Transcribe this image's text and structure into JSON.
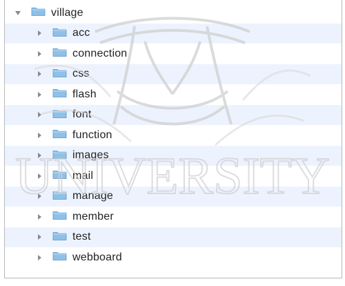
{
  "window": {
    "root_folder": {
      "name": "village",
      "icon": "folder-icon",
      "expanded": true
    },
    "children": [
      {
        "name": "acc",
        "icon": "folder-icon",
        "expanded": false
      },
      {
        "name": "connection",
        "icon": "folder-icon",
        "expanded": false
      },
      {
        "name": "css",
        "icon": "folder-icon",
        "expanded": false
      },
      {
        "name": "flash",
        "icon": "folder-icon",
        "expanded": false
      },
      {
        "name": "font",
        "icon": "folder-icon",
        "expanded": false
      },
      {
        "name": "function",
        "icon": "folder-icon",
        "expanded": false
      },
      {
        "name": "images",
        "icon": "folder-icon",
        "expanded": false
      },
      {
        "name": "mail",
        "icon": "folder-icon",
        "expanded": false
      },
      {
        "name": "manage",
        "icon": "folder-icon",
        "expanded": false
      },
      {
        "name": "member",
        "icon": "folder-icon",
        "expanded": false
      },
      {
        "name": "test",
        "icon": "folder-icon",
        "expanded": false
      },
      {
        "name": "webboard",
        "icon": "folder-icon",
        "expanded": false
      }
    ]
  },
  "watermark": {
    "text": "UNIVERSITY",
    "kind": "university-seal-watermark"
  },
  "colors": {
    "stripe": "#edf3fe",
    "folder_body": "#8fc1e8",
    "folder_tab": "#6ea9d8",
    "disclosure": "#8a8a8a",
    "watermark": "#d8d8d8"
  }
}
